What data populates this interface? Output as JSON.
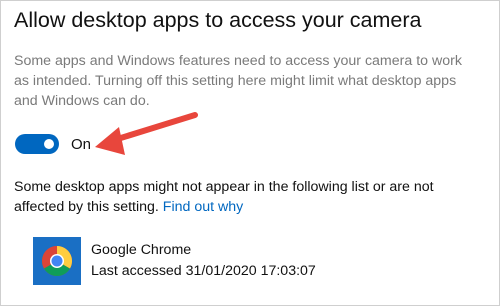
{
  "section": {
    "title": "Allow desktop apps to access your camera",
    "description_lines": [
      "Some apps and Windows features need to access your camera to work",
      "as intended. Turning off this setting here might limit what desktop apps",
      "and Windows can do."
    ]
  },
  "toggle": {
    "state_label": "On",
    "is_on": true
  },
  "info": {
    "line1": "Some desktop apps might not appear in the following list or are not",
    "line2": "affected by this setting. ",
    "link_label": "Find out why"
  },
  "apps": [
    {
      "name": "Google Chrome",
      "last_accessed": "Last accessed 31/01/2020 17:03:07",
      "icon": "chrome-icon"
    }
  ],
  "annotation": {
    "icon": "red-arrow-icon",
    "color": "#e8463c"
  },
  "colors": {
    "accent": "#0067c0",
    "description_text": "#7a7a7a"
  }
}
